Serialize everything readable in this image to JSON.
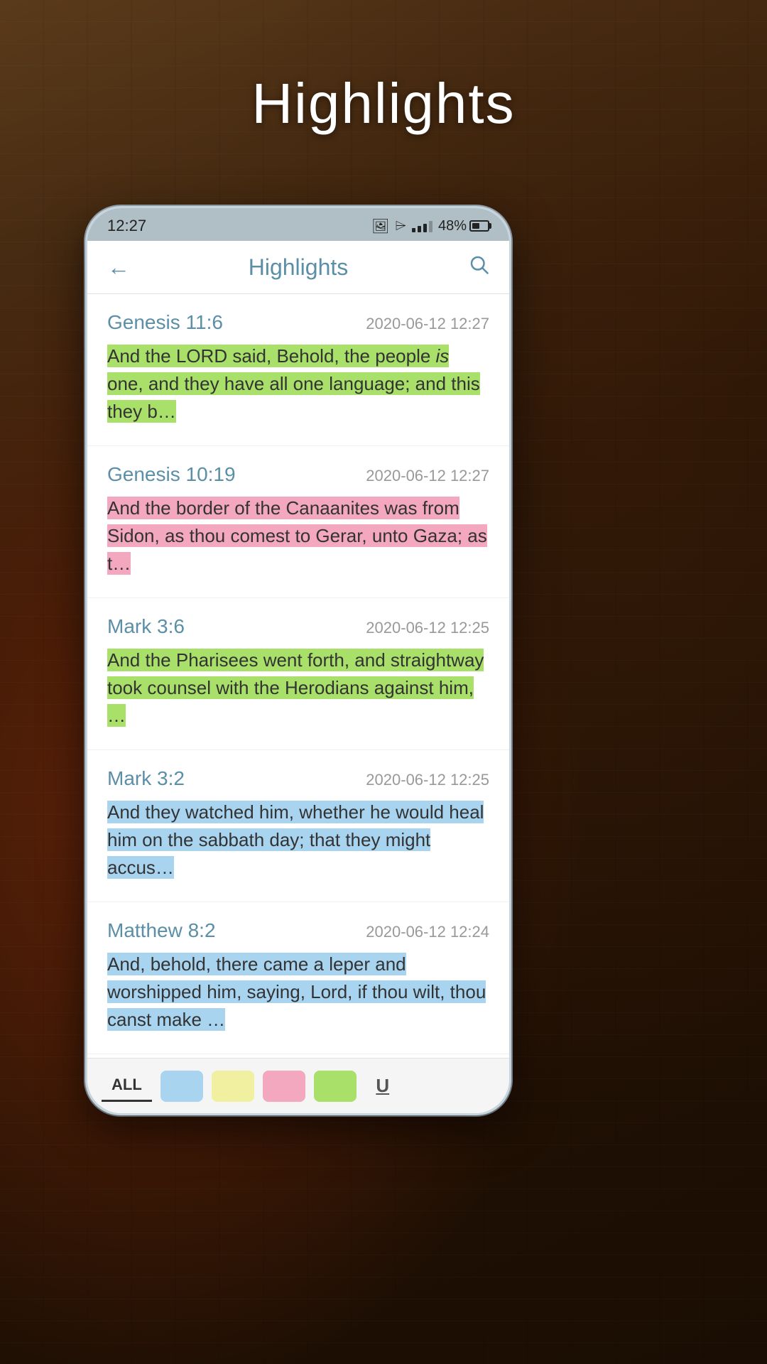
{
  "app": {
    "page_title": "Highlights",
    "header": {
      "title": "Highlights",
      "back_label": "←",
      "search_label": "🔍"
    }
  },
  "status_bar": {
    "time": "12:27",
    "battery_percent": "48%"
  },
  "highlights": [
    {
      "ref": "Genesis 11:6",
      "date": "2020-06-12 12:27",
      "text_prefix": "And the LORD said, Behold, the people ",
      "text_italic": "is",
      "text_suffix": " one, and they have all one language; and this they b…",
      "highlight_color": "green",
      "full_text": "And the LORD said, Behold, the people is one, and they have all one language; and this they b…"
    },
    {
      "ref": "Genesis 10:19",
      "date": "2020-06-12 12:27",
      "text": "And the border of the Canaanites was from Sidon, as thou comest to Gerar, unto Gaza; as t…",
      "highlight_color": "pink"
    },
    {
      "ref": "Mark 3:6",
      "date": "2020-06-12 12:25",
      "text": "And the Pharisees went forth, and straightway took counsel with the Herodians against him, …",
      "highlight_color": "green"
    },
    {
      "ref": "Mark 3:2",
      "date": "2020-06-12 12:25",
      "text": "And they watched him, whether he would heal him on the sabbath day; that they might accus…",
      "highlight_color": "blue"
    },
    {
      "ref": "Matthew 8:2",
      "date": "2020-06-12 12:24",
      "text": "And, behold, there came a leper and worshipped him, saying, Lord, if thou wilt, thou canst make …",
      "highlight_color": "blue"
    }
  ],
  "filter_bar": {
    "all_label": "ALL",
    "underline_label": "U",
    "colors": [
      "#a8d4f0",
      "#f0f0a0",
      "#f4a8c0",
      "#a8e06a"
    ]
  }
}
